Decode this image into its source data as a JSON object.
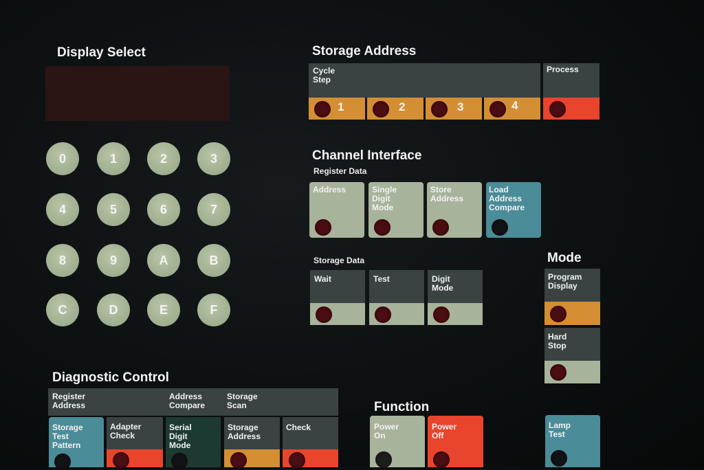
{
  "display_select": {
    "heading": "Display Select",
    "keys": [
      "0",
      "1",
      "2",
      "3",
      "4",
      "5",
      "6",
      "7",
      "8",
      "9",
      "A",
      "B",
      "C",
      "D",
      "E",
      "F"
    ]
  },
  "storage_address": {
    "heading": "Storage Address",
    "cycle_step_label": "Cycle\nStep",
    "process_label": "Process",
    "steps": [
      "1",
      "2",
      "3",
      "4"
    ]
  },
  "channel_interface": {
    "heading": "Channel Interface",
    "register_data_label": "Register Data",
    "register_buttons": [
      "Address",
      "Single\nDigit\nMode",
      "Store\nAddress",
      "Load\nAddress\nCompare"
    ],
    "storage_data_label": "Storage Data",
    "storage_buttons": [
      "Wait",
      "Test",
      "Digit\nMode"
    ]
  },
  "mode": {
    "heading": "Mode",
    "buttons": [
      "Program\nDisplay",
      "Hard\nStop",
      "Lamp\nTest"
    ]
  },
  "diagnostic_control": {
    "heading": "Diagnostic Control",
    "groups": [
      "Register\nAddress",
      "Address\nCompare",
      "Storage\nScan"
    ],
    "buttons": [
      "Storage\nTest\nPattern",
      "Adapter\nCheck",
      "Serial\nDigit\nMode",
      "Storage\nAddress",
      "Check"
    ]
  },
  "function": {
    "heading": "Function",
    "buttons": [
      "Power\nOn",
      "Power\nOff"
    ]
  },
  "colors": {
    "orange": "#d48e33",
    "red": "#e8452c",
    "sage": "#a8b39c",
    "gray": "#3a4242",
    "blue": "#4a8c98",
    "lamp": "#4a0d12"
  }
}
